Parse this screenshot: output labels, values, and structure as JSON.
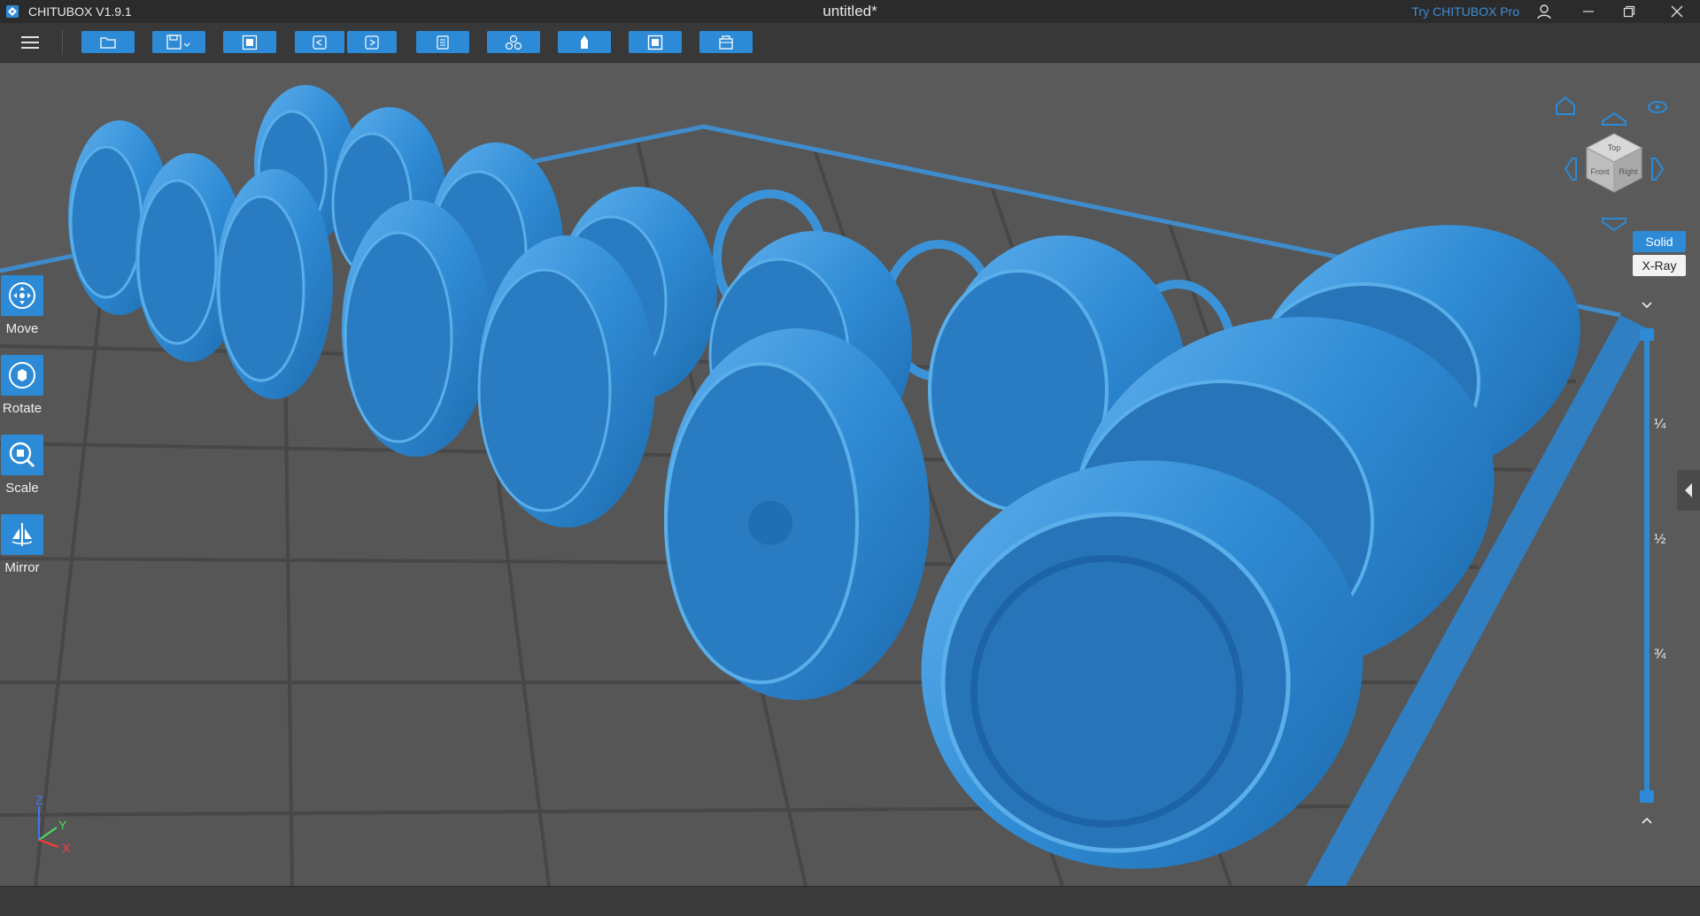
{
  "titlebar": {
    "app_name": "CHITUBOX V1.9.1",
    "doc_title": "untitled*",
    "try_pro": "Try CHITUBOX Pro"
  },
  "toolbar": {
    "buttons": [
      {
        "name": "open-file-button",
        "icon": "folder-icon"
      },
      {
        "name": "save-button",
        "icon": "save-icon"
      },
      {
        "name": "auto-layout-button",
        "icon": "layout-icon"
      },
      {
        "name": "undo-button",
        "icon": "undo-icon"
      },
      {
        "name": "redo-button",
        "icon": "redo-icon"
      },
      {
        "name": "settings-button",
        "icon": "settings-icon"
      },
      {
        "name": "multi-model-button",
        "icon": "models-icon"
      },
      {
        "name": "support-button",
        "icon": "support-icon"
      },
      {
        "name": "hollow-button",
        "icon": "hollow-icon"
      },
      {
        "name": "slice-button",
        "icon": "slice-icon"
      }
    ]
  },
  "side_tools": [
    {
      "label": "Move",
      "icon": "move-icon"
    },
    {
      "label": "Rotate",
      "icon": "rotate-icon"
    },
    {
      "label": "Scale",
      "icon": "scale-icon"
    },
    {
      "label": "Mirror",
      "icon": "mirror-icon"
    }
  ],
  "nav_cube": {
    "top": "Top",
    "front": "Front",
    "right": "Right"
  },
  "render_modes": {
    "solid": "Solid",
    "xray": "X-Ray",
    "active": "Solid"
  },
  "layer_slider": {
    "quarter": "¼",
    "half": "½",
    "three_quarter": "¾",
    "upper_value": 1.0,
    "lower_value": 0.0
  },
  "axis": {
    "z": "Z",
    "y": "Y",
    "x": "X"
  },
  "colors": {
    "accent": "#2c8ad6",
    "model": "#3a93d8",
    "background": "#5a5a5a",
    "grid": "#4a4a4a",
    "axis_z": "#3f74ff",
    "axis_y": "#4cd964",
    "axis_x": "#ff3b30"
  }
}
